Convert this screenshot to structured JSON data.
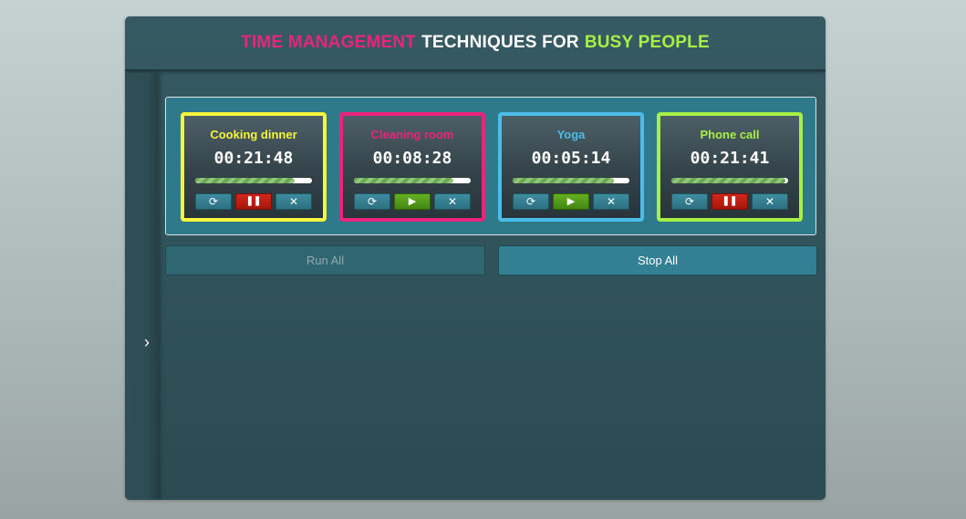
{
  "header": {
    "title_part1": "TIME MANAGEMENT",
    "title_part2": "TECHNIQUES FOR",
    "title_part3": "BUSY PEOPLE",
    "colors": {
      "part1": "#e8247c",
      "part2": "#ffffff",
      "part3": "#a6f046"
    }
  },
  "sidebar": {
    "toggle_icon": "chevron-right-icon",
    "toggle_glyph": "›"
  },
  "timers": [
    {
      "title": "Cooking dinner",
      "time": "00:21:48",
      "color": "#f7f43c",
      "progress": 0.85,
      "state": "running",
      "toggle_icon": "pause-icon"
    },
    {
      "title": "Cleaning room",
      "time": "00:08:28",
      "color": "#e8247c",
      "progress": 0.85,
      "state": "paused",
      "toggle_icon": "play-icon"
    },
    {
      "title": "Yoga",
      "time": "00:05:14",
      "color": "#4bbde8",
      "progress": 0.87,
      "state": "paused",
      "toggle_icon": "play-icon"
    },
    {
      "title": "Phone call",
      "time": "00:21:41",
      "color": "#a6f046",
      "progress": 0.98,
      "state": "running",
      "toggle_icon": "pause-icon"
    }
  ],
  "icons": {
    "reset": "⟳",
    "pause": "❚❚",
    "play": "▶",
    "close": "✕"
  },
  "actions": {
    "run_all": "Run All",
    "stop_all": "Stop All"
  }
}
